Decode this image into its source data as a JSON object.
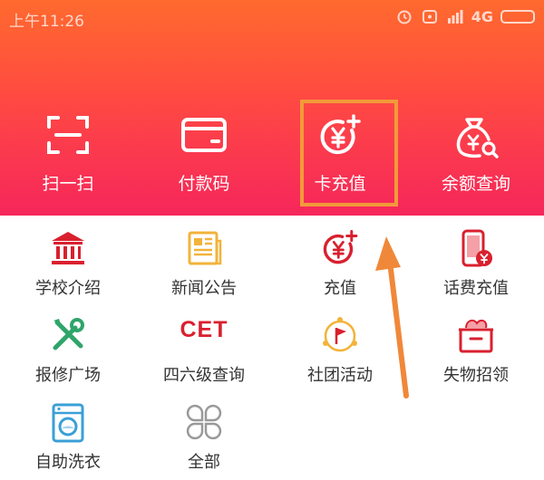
{
  "status_bar": {
    "time": "上午11:26",
    "network": "4G"
  },
  "top_actions": [
    {
      "label": "扫一扫",
      "icon": "scan-icon"
    },
    {
      "label": "付款码",
      "icon": "card-icon"
    },
    {
      "label": "卡充值",
      "icon": "yuan-plus-icon"
    },
    {
      "label": "余额查询",
      "icon": "money-bag-search-icon"
    }
  ],
  "services": [
    {
      "label": "学校介绍",
      "icon": "school-icon"
    },
    {
      "label": "新闻公告",
      "icon": "news-icon"
    },
    {
      "label": "充值",
      "icon": "yuan-plus-icon"
    },
    {
      "label": "话费充值",
      "icon": "phone-yuan-icon"
    },
    {
      "label": "报修广场",
      "icon": "tools-icon"
    },
    {
      "label": "四六级查询",
      "icon": "cet-icon",
      "icon_text": "CET"
    },
    {
      "label": "社团活动",
      "icon": "flag-circle-icon"
    },
    {
      "label": "失物招领",
      "icon": "lost-box-icon"
    },
    {
      "label": "自助洗衣",
      "icon": "washing-machine-icon"
    },
    {
      "label": "全部",
      "icon": "all-grid-icon"
    }
  ],
  "colors": {
    "gradient_top": "#ff6a2e",
    "gradient_bottom": "#f6265b",
    "highlight_box": "#f29a3a",
    "arrow": "#f0883a",
    "icon_red": "#d9202f",
    "icon_yellow": "#f2b33a",
    "icon_green": "#2fa56a"
  }
}
